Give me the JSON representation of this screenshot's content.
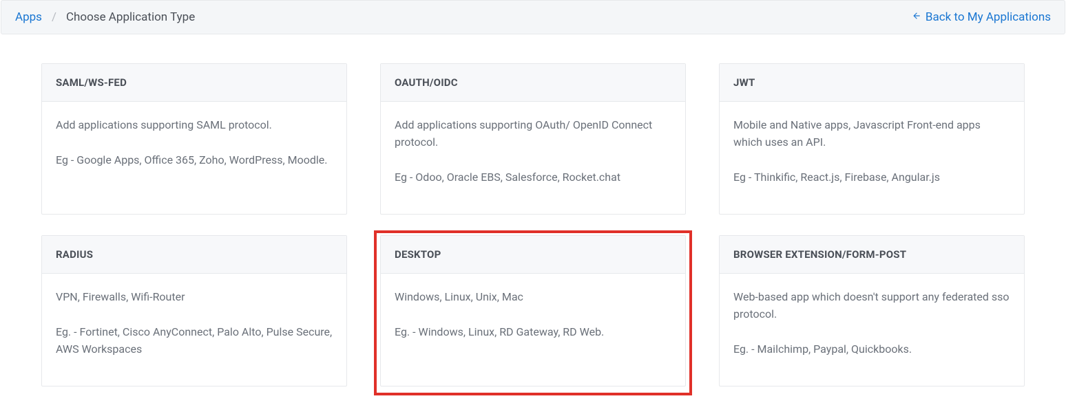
{
  "breadcrumb": {
    "root": "Apps",
    "separator": "/",
    "current": "Choose Application Type"
  },
  "back_link": "Back to My Applications",
  "cards": [
    {
      "title": "SAML/WS-FED",
      "description": "Add applications supporting SAML protocol.",
      "example": "Eg - Google Apps, Office 365, Zoho, WordPress, Moodle."
    },
    {
      "title": "OAUTH/OIDC",
      "description": "Add applications supporting OAuth/ OpenID Connect protocol.",
      "example": "Eg - Odoo, Oracle EBS, Salesforce, Rocket.chat"
    },
    {
      "title": "JWT",
      "description": "Mobile and Native apps, Javascript Front-end apps which uses an API.",
      "example": "Eg - Thinkific, React.js, Firebase, Angular.js"
    },
    {
      "title": "RADIUS",
      "description": "VPN, Firewalls, Wifi-Router",
      "example": "Eg. - Fortinet, Cisco AnyConnect, Palo Alto, Pulse Secure, AWS Workspaces"
    },
    {
      "title": "DESKTOP",
      "description": "Windows, Linux, Unix, Mac",
      "example": "Eg. - Windows, Linux, RD Gateway, RD Web."
    },
    {
      "title": "BROWSER EXTENSION/FORM-POST",
      "description": "Web-based app which doesn't support any federated sso protocol.",
      "example": "Eg. - Mailchimp, Paypal, Quickbooks."
    }
  ],
  "highlighted_card_index": 4
}
